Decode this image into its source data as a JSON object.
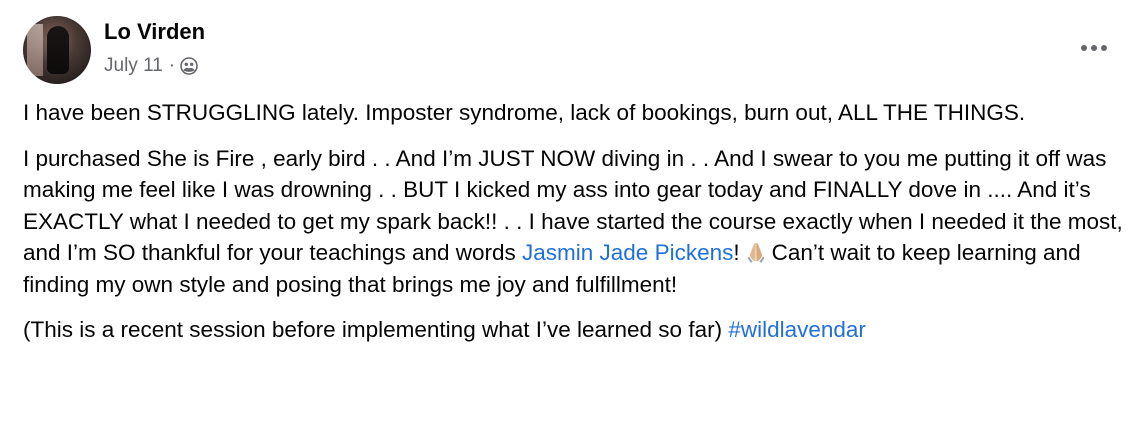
{
  "post": {
    "author": "Lo Virden",
    "date": "July 11",
    "separator": "·",
    "audience_icon": "friends-icon",
    "more_icon": "more-options-icon",
    "paragraphs": {
      "p1": "I have been STRUGGLING lately. Imposter syndrome, lack of bookings, burn out, ALL THE THINGS.",
      "p2_before": "I purchased She is Fire , early bird . . And I’m JUST NOW diving in . . And I swear to you me putting it off was making me feel like I was drowning . . BUT I kicked my ass into gear today and FINALLY dove in .... And it’s EXACTLY what I needed to get my spark back!! . . I have started the course exactly when I needed it the most, and I’m SO thankful for your teachings and words ",
      "p2_mention": "Jasmin Jade Pickens",
      "p2_after_mention": "!",
      "p2_emoji": "folded-hands-emoji",
      "p2_end": "Can’t wait to keep learning and finding my own style and posing that brings me joy and fulfillment!",
      "p3_before": "(This is a recent session before implementing what I’ve learned so far) ",
      "p3_hashtag": "#wildlavendar"
    },
    "colors": {
      "link": "#216fdb",
      "secondary_text": "#65676b",
      "primary_text": "#050505"
    }
  }
}
